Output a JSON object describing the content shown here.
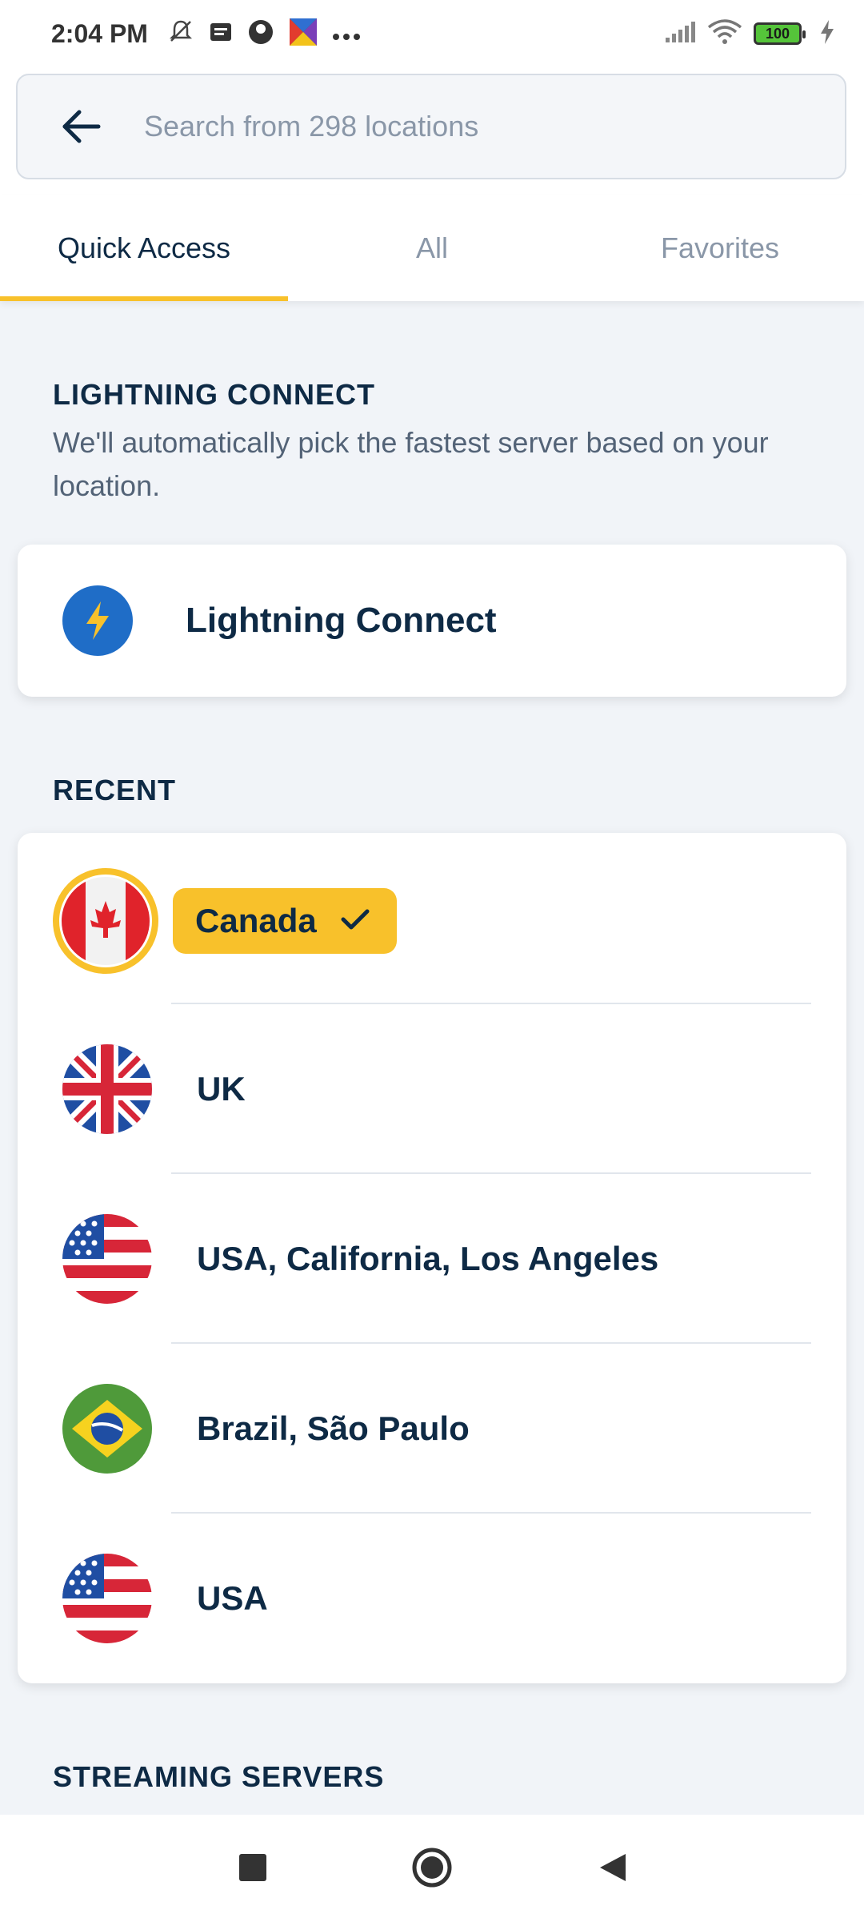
{
  "status_bar": {
    "time": "2:04 PM",
    "battery": "100",
    "icons_left": [
      "mute-icon",
      "message-icon",
      "app-icon",
      "app-icon",
      "more-icon"
    ],
    "icons_right": [
      "signal-icon",
      "wifi-icon",
      "battery-icon",
      "charging-icon"
    ]
  },
  "search": {
    "placeholder": "Search from 298 locations"
  },
  "tabs": [
    {
      "label": "Quick Access",
      "active": true
    },
    {
      "label": "All",
      "active": false
    },
    {
      "label": "Favorites",
      "active": false
    }
  ],
  "lightning": {
    "title": "LIGHTNING CONNECT",
    "description": "We'll automatically pick the fastest server based on your location.",
    "button_label": "Lightning Connect"
  },
  "recent": {
    "title": "RECENT",
    "items": [
      {
        "label": "Canada",
        "selected": true,
        "flag": "canada-flag-icon"
      },
      {
        "label": "UK",
        "selected": false,
        "flag": "uk-flag-icon"
      },
      {
        "label": "USA, California, Los Angeles",
        "selected": false,
        "flag": "usa-flag-icon"
      },
      {
        "label": "Brazil, São Paulo",
        "selected": false,
        "flag": "brazil-flag-icon"
      },
      {
        "label": "USA",
        "selected": false,
        "flag": "usa-flag-icon"
      }
    ]
  },
  "streaming": {
    "title": "STREAMING SERVERS"
  },
  "colors": {
    "accent": "#f8c12b",
    "primary_text": "#0e2a45",
    "muted_text": "#8a97a8",
    "background": "#f1f4f8"
  }
}
